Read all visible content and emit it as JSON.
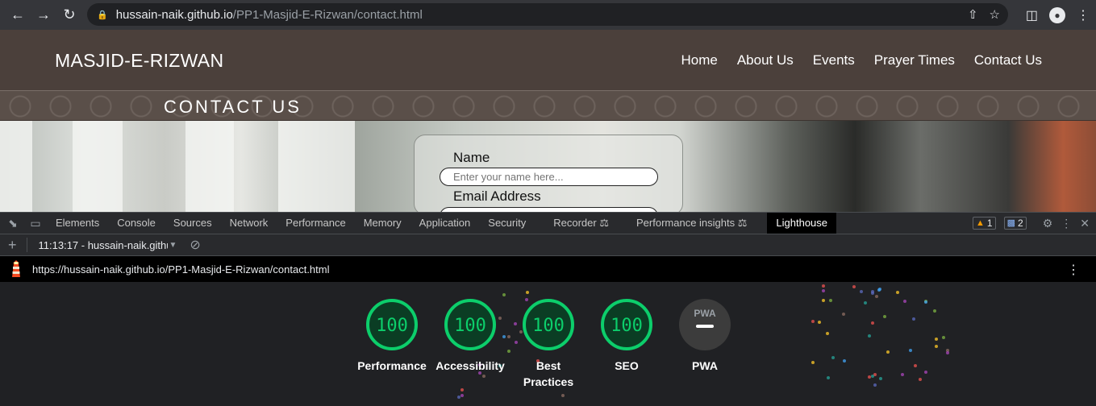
{
  "browser": {
    "url_host": "hussain-naik.github.io",
    "url_path": "/PP1-Masjid-E-Rizwan/contact.html"
  },
  "site": {
    "logo": "MASJID-E-RIZWAN",
    "nav": [
      "Home",
      "About Us",
      "Events",
      "Prayer Times",
      "Contact Us"
    ],
    "banner_title": "CONTACT US",
    "form": {
      "name_label": "Name",
      "name_placeholder": "Enter your name here...",
      "email_label": "Email Address"
    }
  },
  "devtools": {
    "tabs": [
      "Elements",
      "Console",
      "Sources",
      "Network",
      "Performance",
      "Memory",
      "Application",
      "Security",
      "Recorder",
      "Performance insights",
      "Lighthouse"
    ],
    "active_tab": "Lighthouse",
    "warnings_count": "1",
    "messages_count": "2",
    "report_select": "11:13:17 - hussain-naik.github",
    "lighthouse_url": "https://hussain-naik.github.io/PP1-Masjid-E-Rizwan/contact.html",
    "scores": [
      {
        "label": "Performance",
        "score": "100"
      },
      {
        "label": "Accessibility",
        "score": "100"
      },
      {
        "label": "Best Practices",
        "score": "100"
      },
      {
        "label": "SEO",
        "score": "100"
      }
    ],
    "pwa_label": "PWA",
    "pwa_badge": "PWA",
    "colors": {
      "pass": "#0cce6b",
      "pass_bg": "#0b3d24",
      "pwa_bg": "#3c3c3c"
    }
  }
}
